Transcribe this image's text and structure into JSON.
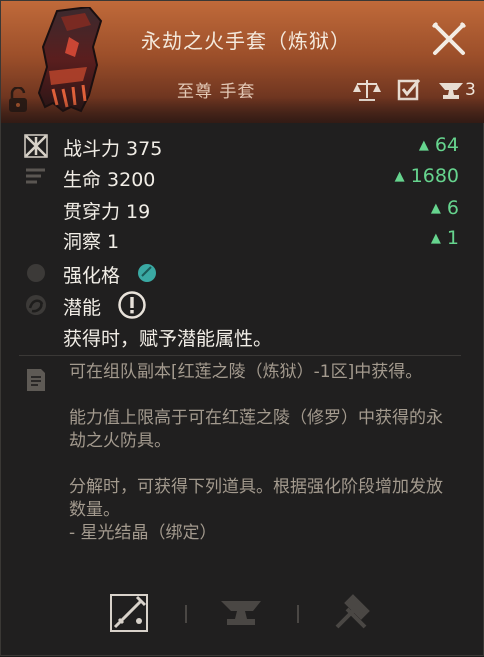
{
  "header": {
    "title": "永劫之火手套（炼狱）",
    "subtitle": "至尊 手套",
    "anvil_count": "3"
  },
  "stats": [
    {
      "label": "战斗力 375",
      "delta": "64",
      "icon": "combat-power-icon"
    },
    {
      "label": "生命 3200",
      "delta": "1680",
      "icon": "lines-icon"
    },
    {
      "label": "贯穿力 19",
      "delta": "6"
    },
    {
      "label": "洞察 1",
      "delta": "1"
    }
  ],
  "enhance": {
    "label": "强化格"
  },
  "potential": {
    "label": "潜能",
    "note": "获得时，赋予潜能属性。"
  },
  "description": "可在组队副本[红莲之陵（炼狱）-1区]中获得。\n\n能力值上限高于可在红莲之陵（修罗）中获得的永劫之火防具。\n\n分解时，可获得下列道具。根据强化阶段增加发放数量。\n- 星光结晶（绑定）",
  "colors": {
    "accent_up": "#66d48e",
    "potential_text": "#e772d9",
    "header": "#a8552d"
  }
}
